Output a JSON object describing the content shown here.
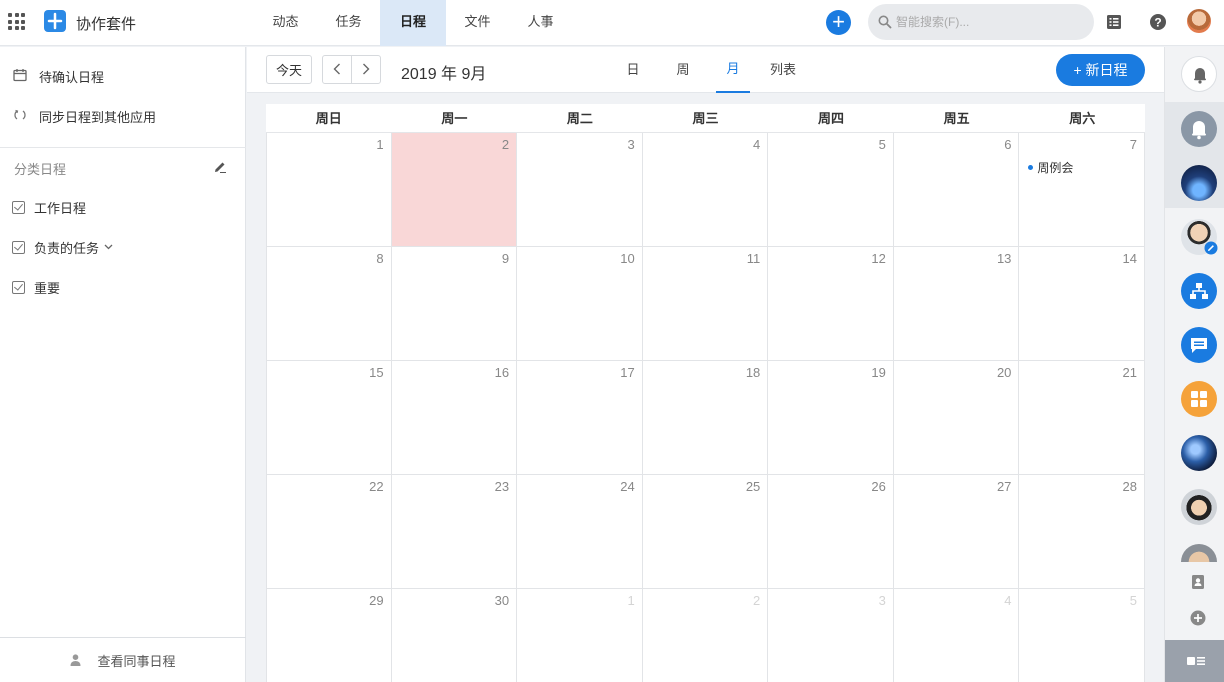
{
  "app": {
    "name": "协作套件"
  },
  "nav": {
    "tabs": [
      "动态",
      "任务",
      "日程",
      "文件",
      "人事"
    ],
    "active": "日程"
  },
  "search": {
    "placeholder": "智能搜索(F)..."
  },
  "sidebar": {
    "pending": "待确认日程",
    "sync": "同步日程到其他应用",
    "category_heading": "分类日程",
    "categories": [
      "工作日程",
      "负责的任务",
      "重要"
    ],
    "colleague_link": "查看同事日程"
  },
  "toolbar": {
    "today_label": "今天",
    "prev_label": "‹",
    "next_label": "›",
    "month_label": "2019 年 9月",
    "views": [
      "日",
      "周",
      "月",
      "列表"
    ],
    "active_view": "月",
    "new_button": "+ 新日程"
  },
  "calendar": {
    "weekdays": [
      "周日",
      "周一",
      "周二",
      "周三",
      "周四",
      "周五",
      "周六"
    ],
    "weeks": [
      [
        "1",
        "2",
        "3",
        "4",
        "5",
        "6",
        "7"
      ],
      [
        "8",
        "9",
        "10",
        "11",
        "12",
        "13",
        "14"
      ],
      [
        "15",
        "16",
        "17",
        "18",
        "19",
        "20",
        "21"
      ],
      [
        "22",
        "23",
        "24",
        "25",
        "26",
        "27",
        "28"
      ],
      [
        "29",
        "30",
        "1",
        "2",
        "3",
        "4",
        "5"
      ]
    ],
    "event": {
      "title": "周例会"
    }
  },
  "colors": {
    "accent": "#1a7be0",
    "today_bg": "#f9d7d7",
    "event_dot": "#1a7be0"
  },
  "rail": {
    "icons": [
      "bell-icon",
      "notification-icon",
      "contact-avatar-city",
      "contact-avatar-man",
      "org-chart-icon",
      "message-icon",
      "apps-grid-icon",
      "contact-avatar-earth",
      "contact-avatar-man-2",
      "contact-avatar-partial",
      "contacts-icon",
      "add-contact-icon",
      "collapse-panel-icon"
    ]
  }
}
